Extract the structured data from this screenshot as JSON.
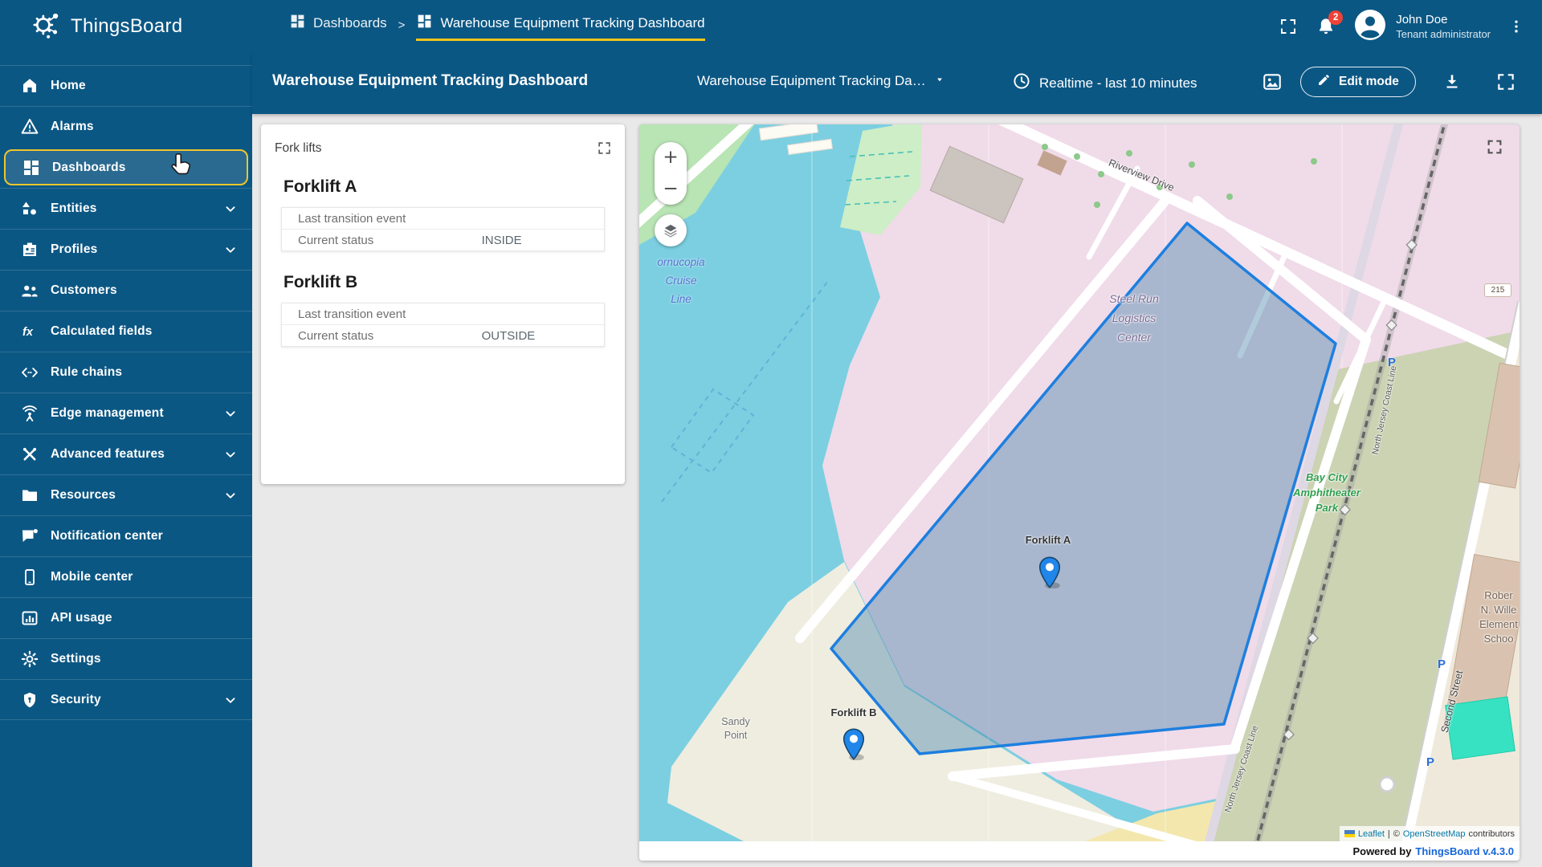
{
  "colors": {
    "header_bg": "#0b5784",
    "accent_yellow": "#f2c51b",
    "badge_red": "#ef4237",
    "zone_blue": "#1d7fe0",
    "marker_blue": "#2186ea",
    "link_blue": "#1565d8"
  },
  "header": {
    "app_name": "ThingsBoard",
    "breadcrumb_root": "Dashboards",
    "breadcrumb_sep": ">",
    "breadcrumb_current": "Warehouse Equipment Tracking Dashboard",
    "notification_count": "2",
    "user_name": "John Doe",
    "user_role": "Tenant administrator"
  },
  "toolbar": {
    "page_title": "Warehouse Equipment Tracking Dashboard",
    "dashboard_select_value": "Warehouse Equipment Tracking Da…",
    "time_window": "Realtime - last 10 minutes",
    "edit_mode_label": "Edit mode"
  },
  "sidebar": {
    "fx_icon_text": "fx",
    "items": [
      {
        "label": "Home"
      },
      {
        "label": "Alarms"
      },
      {
        "label": "Dashboards"
      },
      {
        "label": "Entities"
      },
      {
        "label": "Profiles"
      },
      {
        "label": "Customers"
      },
      {
        "label": "Calculated fields"
      },
      {
        "label": "Rule chains"
      },
      {
        "label": "Edge management"
      },
      {
        "label": "Advanced features"
      },
      {
        "label": "Resources"
      },
      {
        "label": "Notification center"
      },
      {
        "label": "Mobile center"
      },
      {
        "label": "API usage"
      },
      {
        "label": "Settings"
      },
      {
        "label": "Security"
      }
    ]
  },
  "forklifts_widget": {
    "title": "Fork lifts",
    "devices": [
      {
        "name": "Forklift A",
        "rows": [
          {
            "label": "Last transition event",
            "value": ""
          },
          {
            "label": "Current status",
            "value": "INSIDE"
          }
        ]
      },
      {
        "name": "Forklift B",
        "rows": [
          {
            "label": "Last transition event",
            "value": ""
          },
          {
            "label": "Current status",
            "value": "OUTSIDE"
          }
        ]
      }
    ]
  },
  "map": {
    "zoom_in": "+",
    "zoom_out": "−",
    "markers": [
      {
        "label": "Forklift A"
      },
      {
        "label": "Forklift B"
      }
    ],
    "labels": {
      "cruise": [
        "ornucopia",
        "Cruise",
        "Line"
      ],
      "riverview": "Riverview Drive",
      "steel": [
        "Steel Run",
        "Logistics",
        "Center"
      ],
      "bay": [
        "Bay City",
        "Amphitheater",
        "Park"
      ],
      "sandy": [
        "Sandy",
        "Point"
      ],
      "second_street": "Second Street",
      "school": [
        "Rober",
        "N. Wille",
        "Element",
        "Schoo"
      ],
      "rail_line": "North Jersey Coast Line",
      "road_badge": "215",
      "parking": "P"
    },
    "attribution": {
      "leaflet": "Leaflet",
      "divider": "|",
      "copyright": "©",
      "osm": "OpenStreetMap",
      "contributors": "contributors"
    },
    "powered_by": "Powered by",
    "version_link": "ThingsBoard v.4.3.0"
  }
}
